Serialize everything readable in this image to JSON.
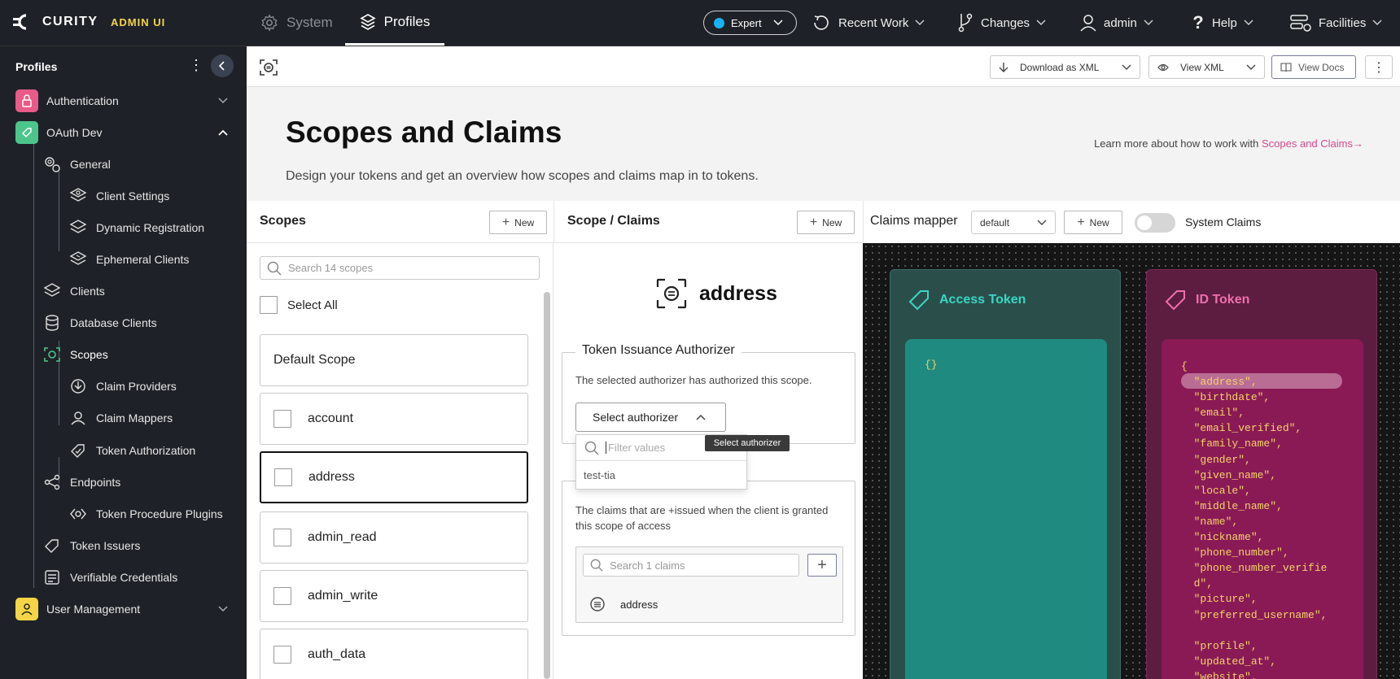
{
  "topbar": {
    "brand": "CURITY",
    "admin_ui": "ADMIN UI",
    "tabs": {
      "system": "System",
      "profiles": "Profiles"
    },
    "mode": "Expert",
    "menus": {
      "recent_work": "Recent Work",
      "changes": "Changes",
      "user": "admin",
      "help": "Help",
      "facilities": "Facilities"
    }
  },
  "sidebar": {
    "title": "Profiles",
    "authentication": "Authentication",
    "oauth_dev": "OAuth Dev",
    "general": "General",
    "client_settings": "Client Settings",
    "dynamic_registration": "Dynamic Registration",
    "ephemeral_clients": "Ephemeral Clients",
    "clients": "Clients",
    "database_clients": "Database Clients",
    "scopes": "Scopes",
    "claim_providers": "Claim Providers",
    "claim_mappers": "Claim Mappers",
    "token_authorization": "Token Authorization",
    "endpoints": "Endpoints",
    "token_procedure_plugins": "Token Procedure Plugins",
    "token_issuers": "Token Issuers",
    "verifiable_credentials": "Verifiable Credentials",
    "user_management": "User Management"
  },
  "toolbar": {
    "download_xml": "Download as XML",
    "view_xml": "View XML",
    "view_docs": "View Docs"
  },
  "header": {
    "title": "Scopes and Claims",
    "subtitle": "Design your tokens and get an overview how scopes and claims map in to tokens.",
    "learn_prefix": "Learn more about how to work with ",
    "learn_link": "Scopes and Claims→"
  },
  "scopes": {
    "title": "Scopes",
    "new_label": "New",
    "search_placeholder": "Search 14 scopes",
    "select_all": "Select All",
    "default_scope": "Default Scope",
    "items": [
      "account",
      "address",
      "admin_read",
      "admin_write",
      "auth_data"
    ]
  },
  "scope_claims": {
    "title": "Scope / Claims",
    "new_label": "New",
    "scope_name": "address",
    "tia_legend": "Token Issuance Authorizer",
    "tia_text": "The selected authorizer has authorized this scope.",
    "select_authorizer": "Select authorizer",
    "tooltip": "Select authorizer",
    "filter_placeholder": "Filter values",
    "options": [
      "test-tia"
    ],
    "claims_text": "The claims that are +issued when the client is granted this scope of access",
    "claims_search_placeholder": "Search 1 claims",
    "claims": [
      "address"
    ]
  },
  "claims_mapper": {
    "title": "Claims mapper",
    "selected": "default",
    "new_label": "New",
    "system_claims": "System Claims",
    "system_claims_enabled": false,
    "access_token": {
      "title": "Access Token",
      "content": "{}"
    },
    "id_token": {
      "title": "ID Token",
      "lines": [
        "{",
        "  \"address\",",
        "  \"birthdate\",",
        "  \"email\",",
        "  \"email_verified\",",
        "  \"family_name\",",
        "  \"gender\",",
        "  \"given_name\",",
        "  \"locale\",",
        "  \"middle_name\",",
        "  \"name\",",
        "  \"nickname\",",
        "  \"phone_number\",",
        "  \"phone_number_verifie",
        "  d\",",
        "  \"picture\",",
        "  \"preferred_username\",",
        "",
        "  \"profile\",",
        "  \"updated_at\",",
        "  \"website\","
      ]
    }
  },
  "colors": {
    "accent_pink": "#d4498d",
    "access_token_bg": "#2a4f4b",
    "access_token_inner": "#1f8a80",
    "access_token_title": "#3ad6c4",
    "id_token_bg": "#5c1d40",
    "id_token_inner": "#8a1a55",
    "id_token_title": "#f06fae",
    "claim_text": "#f3d36a"
  }
}
